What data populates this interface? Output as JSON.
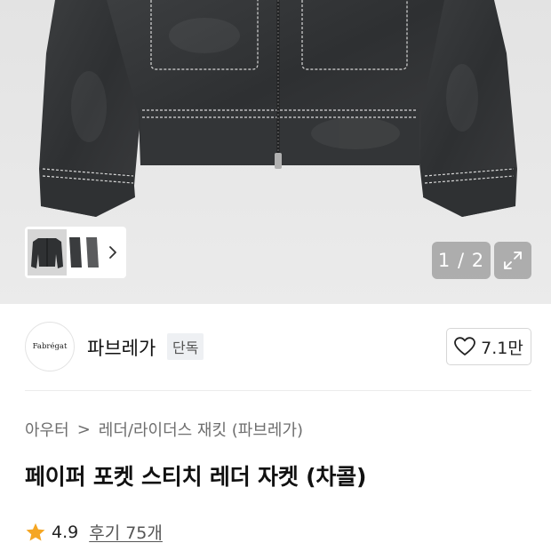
{
  "gallery": {
    "counter": "1 / 2",
    "thumbnails": [
      "jacket-front",
      "jacket-side",
      "jacket-back"
    ],
    "next_icon": "chevron-right-icon",
    "expand_icon": "expand-icon"
  },
  "brand": {
    "logo_text": "Fabrégat",
    "name": "파브레가",
    "badge": "단독",
    "like_icon": "heart-outline-icon",
    "like_count": "7.1만"
  },
  "breadcrumb": {
    "items": [
      "아우터",
      "레더/라이더스 재킷 (파브레가)"
    ],
    "separator": ">"
  },
  "product": {
    "title": "페이퍼 포켓 스티치 레더 자켓 (차콜)"
  },
  "rating": {
    "star_icon": "star-filled-icon",
    "star_color": "#f5a623",
    "score": "4.9",
    "reviews": "후기 75개"
  }
}
